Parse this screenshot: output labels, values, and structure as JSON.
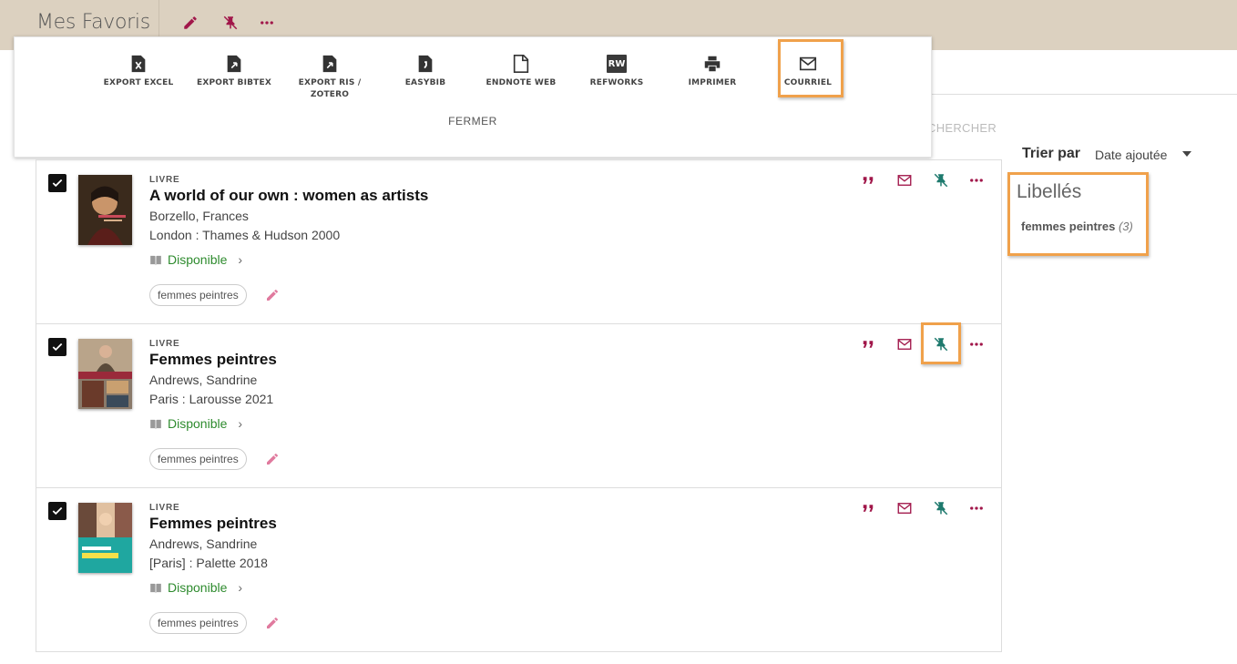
{
  "header": {
    "title": "Mes Favoris",
    "icons": [
      "edit-icon",
      "unpin-icon",
      "more-icon"
    ]
  },
  "search_ghost": "CHERCHER",
  "export_panel": {
    "items": [
      {
        "label": "EXPORT EXCEL",
        "icon": "excel-icon"
      },
      {
        "label": "EXPORT BIBTEX",
        "icon": "bibtex-icon"
      },
      {
        "label": "EXPORT RIS / ZOTERO",
        "icon": "ris-icon"
      },
      {
        "label": "EASYBIB",
        "icon": "easybib-icon"
      },
      {
        "label": "ENDNOTE WEB",
        "icon": "endnote-icon"
      },
      {
        "label": "REFWORKS",
        "icon": "refworks-icon",
        "badge": "RW"
      },
      {
        "label": "IMPRIMER",
        "icon": "print-icon"
      },
      {
        "label": "COURRIEL",
        "icon": "mail-icon"
      }
    ],
    "close_label": "FERMER"
  },
  "sort": {
    "label": "Trier par",
    "value": "Date ajoutée"
  },
  "labels": {
    "title": "Libellés",
    "items": [
      {
        "name": "femmes peintres",
        "count": "(3)"
      }
    ]
  },
  "results": [
    {
      "type": "LIVRE",
      "title": "A world of our own : women as artists",
      "author": "Borzello, Frances",
      "publication": "London : Thames & Hudson 2000",
      "availability": "Disponible",
      "tag": "femmes peintres",
      "checked": true
    },
    {
      "type": "LIVRE",
      "title": "Femmes peintres",
      "author": "Andrews, Sandrine",
      "publication": "Paris : Larousse 2021",
      "availability": "Disponible",
      "tag": "femmes peintres",
      "checked": true
    },
    {
      "type": "LIVRE",
      "title": "Femmes peintres",
      "author": "Andrews, Sandrine",
      "publication": "[Paris] : Palette 2018",
      "availability": "Disponible",
      "tag": "femmes peintres",
      "checked": true
    }
  ],
  "colors": {
    "header_bg": "#dcd1c0",
    "accent": "#a1174a",
    "pin_teal": "#1f7a6e",
    "available_green": "#2e8b2e",
    "highlight_orange": "#f0a14b"
  }
}
